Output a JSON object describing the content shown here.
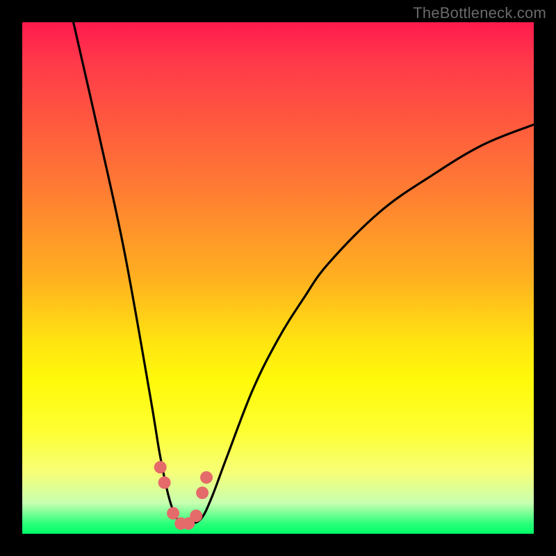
{
  "watermark": "TheBottleneck.com",
  "colors": {
    "bg": "#000000",
    "curve_stroke": "#000000",
    "marker_fill": "#e56a6a",
    "gradient_stops": [
      "#ff1a4d",
      "#ff3a4a",
      "#ff5a3e",
      "#ff7d33",
      "#ffb020",
      "#ffe610",
      "#fff90a",
      "#feff33",
      "#f6ff77",
      "#c8ffb0",
      "#2bff7a",
      "#00ff66"
    ]
  },
  "chart_data": {
    "type": "line",
    "title": "",
    "xlabel": "",
    "ylabel": "",
    "xlim": [
      0,
      100
    ],
    "ylim": [
      0,
      100
    ],
    "series": [
      {
        "name": "bottleneck-curve",
        "x": [
          10,
          15,
          20,
          25,
          27,
          29,
          31,
          33,
          35,
          37,
          40,
          45,
          50,
          55,
          60,
          70,
          80,
          90,
          100
        ],
        "values": [
          100,
          78,
          55,
          27,
          15,
          6,
          2,
          2,
          3,
          7,
          15,
          28,
          38,
          46,
          53,
          63,
          70,
          76,
          80
        ]
      }
    ],
    "markers": {
      "name": "highlighted-points",
      "x": [
        27.0,
        27.8,
        29.5,
        31.0,
        32.5,
        34.0,
        35.2,
        36.0
      ],
      "values": [
        13.0,
        10.0,
        4.0,
        2.0,
        2.0,
        3.5,
        8.0,
        11.0
      ],
      "radius_px": 9
    }
  }
}
